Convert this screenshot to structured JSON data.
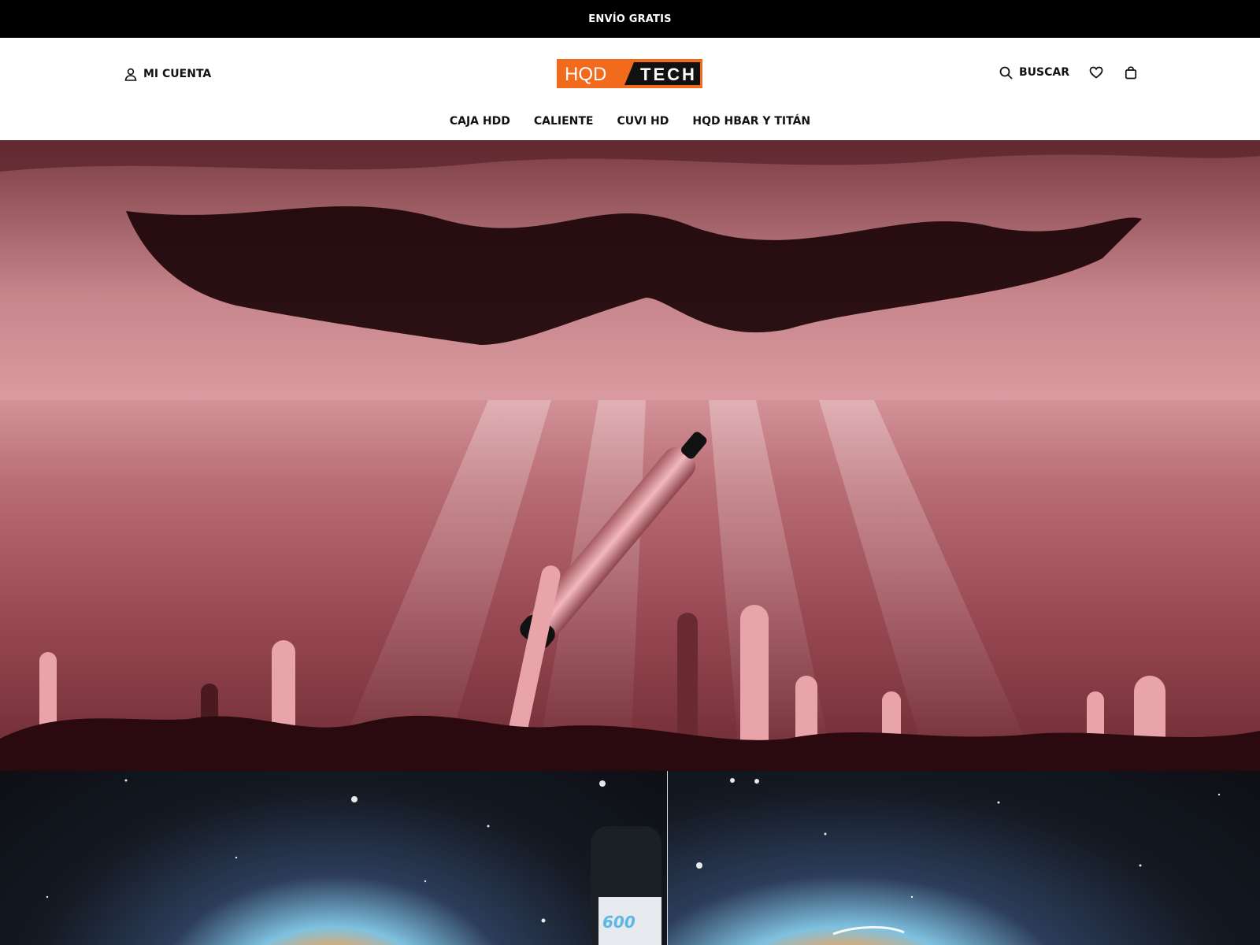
{
  "announcement": {
    "text": "ENVÍO GRATIS"
  },
  "header": {
    "account_label": "MI CUENTA",
    "logo": {
      "left_text": "HQD",
      "right_text": "TECH",
      "accent": "#f26a1b"
    },
    "search_label": "BUSCAR"
  },
  "nav": {
    "items": [
      {
        "label": "CAJA HDD"
      },
      {
        "label": "CALIENTE"
      },
      {
        "label": "CUVI HD"
      },
      {
        "label": "HQD HBAR Y TITÁN"
      }
    ]
  },
  "hero": {
    "device_text": "600"
  },
  "colors": {
    "accent": "#f26a1b",
    "hero_pink": "#d99ba0",
    "announcement_bg": "#000000"
  },
  "icons": [
    "user-icon",
    "search-icon",
    "heart-icon",
    "bag-icon"
  ]
}
